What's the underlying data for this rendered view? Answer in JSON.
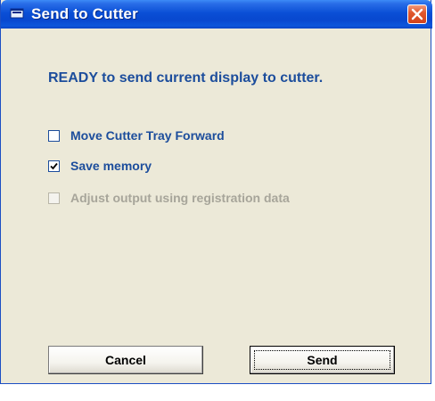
{
  "window": {
    "title": "Send to Cutter",
    "title_icon": "printer-icon",
    "close_icon": "close-icon"
  },
  "message": "READY to send current display to cutter.",
  "options": [
    {
      "label": "Move Cutter Tray Forward",
      "checked": false,
      "enabled": true
    },
    {
      "label": "Save memory",
      "checked": true,
      "enabled": true
    },
    {
      "label": "Adjust output using registration data",
      "checked": false,
      "enabled": false
    }
  ],
  "buttons": {
    "cancel_label": "Cancel",
    "send_label": "Send"
  },
  "colors": {
    "titlebar": "#0a4fd6",
    "dialog_bg": "#ece9d8",
    "label_text": "#1c4d9c",
    "disabled_text": "#a7a59a",
    "close_button": "#d2431b"
  }
}
